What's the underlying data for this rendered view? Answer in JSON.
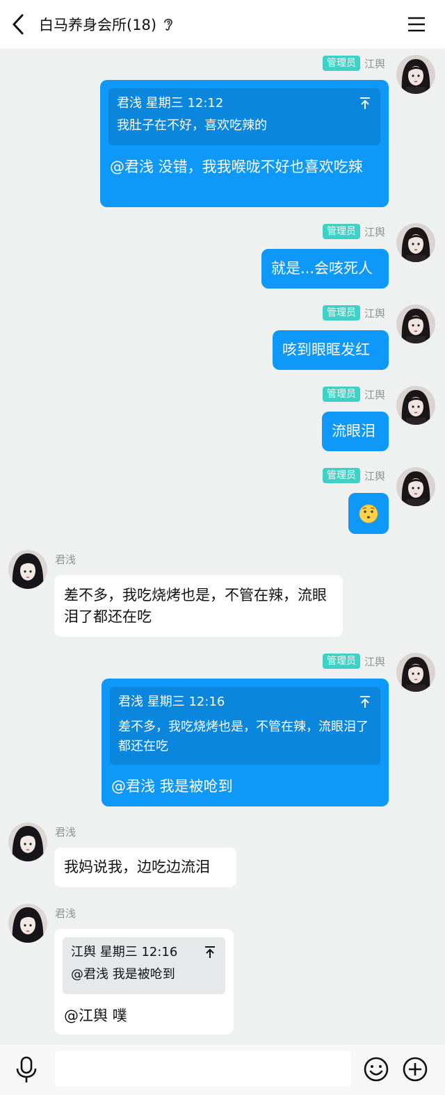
{
  "header": {
    "title": "白马养身会所(18)"
  },
  "messages": [
    {
      "id": 1,
      "sender": "江舆",
      "badge": "管理员",
      "quote": {
        "author_time": "君浅 星期三 12:12",
        "text": "我肚子在不好，喜欢吃辣的"
      },
      "text": "@君浅 没错，我我喉咙不好也喜欢吃辣"
    },
    {
      "id": 2,
      "sender": "江舆",
      "badge": "管理员",
      "text": "就是...会咳死人"
    },
    {
      "id": 3,
      "sender": "江舆",
      "badge": "管理员",
      "text": "咳到眼眶发红"
    },
    {
      "id": 4,
      "sender": "江舆",
      "badge": "管理员",
      "text": "流眼泪"
    },
    {
      "id": 5,
      "sender": "江舆",
      "badge": "管理员",
      "emoji": "confused-face-emoji"
    },
    {
      "id": 6,
      "sender": "君浅",
      "text": "差不多，我吃烧烤也是，不管在辣，流眼泪了都还在吃"
    },
    {
      "id": 7,
      "sender": "江舆",
      "badge": "管理员",
      "quote": {
        "author_time": "君浅 星期三 12:16",
        "text": "差不多，我吃烧烤也是，不管在辣，流眼泪了都还在吃"
      },
      "text": "@君浅 我是被呛到"
    },
    {
      "id": 8,
      "sender": "君浅",
      "text": "我妈说我，边吃边流泪"
    },
    {
      "id": 9,
      "sender": "君浅",
      "quote": {
        "author_time": "江舆 星期三 12:16",
        "text": "@君浅 我是被呛到"
      },
      "text": "@江舆 噗"
    }
  ],
  "input": {
    "placeholder": ""
  },
  "icons": [
    "back-arrow-icon",
    "ear-icon",
    "menu-icon",
    "jump-to-original-icon",
    "microphone-icon",
    "emoji-icon",
    "plus-icon"
  ],
  "colors": {
    "outgoing_bubble": "#0d98fa",
    "incoming_bubble": "#ffffff",
    "background": "#eef1f0",
    "admin_badge": "#3fd1c6"
  }
}
